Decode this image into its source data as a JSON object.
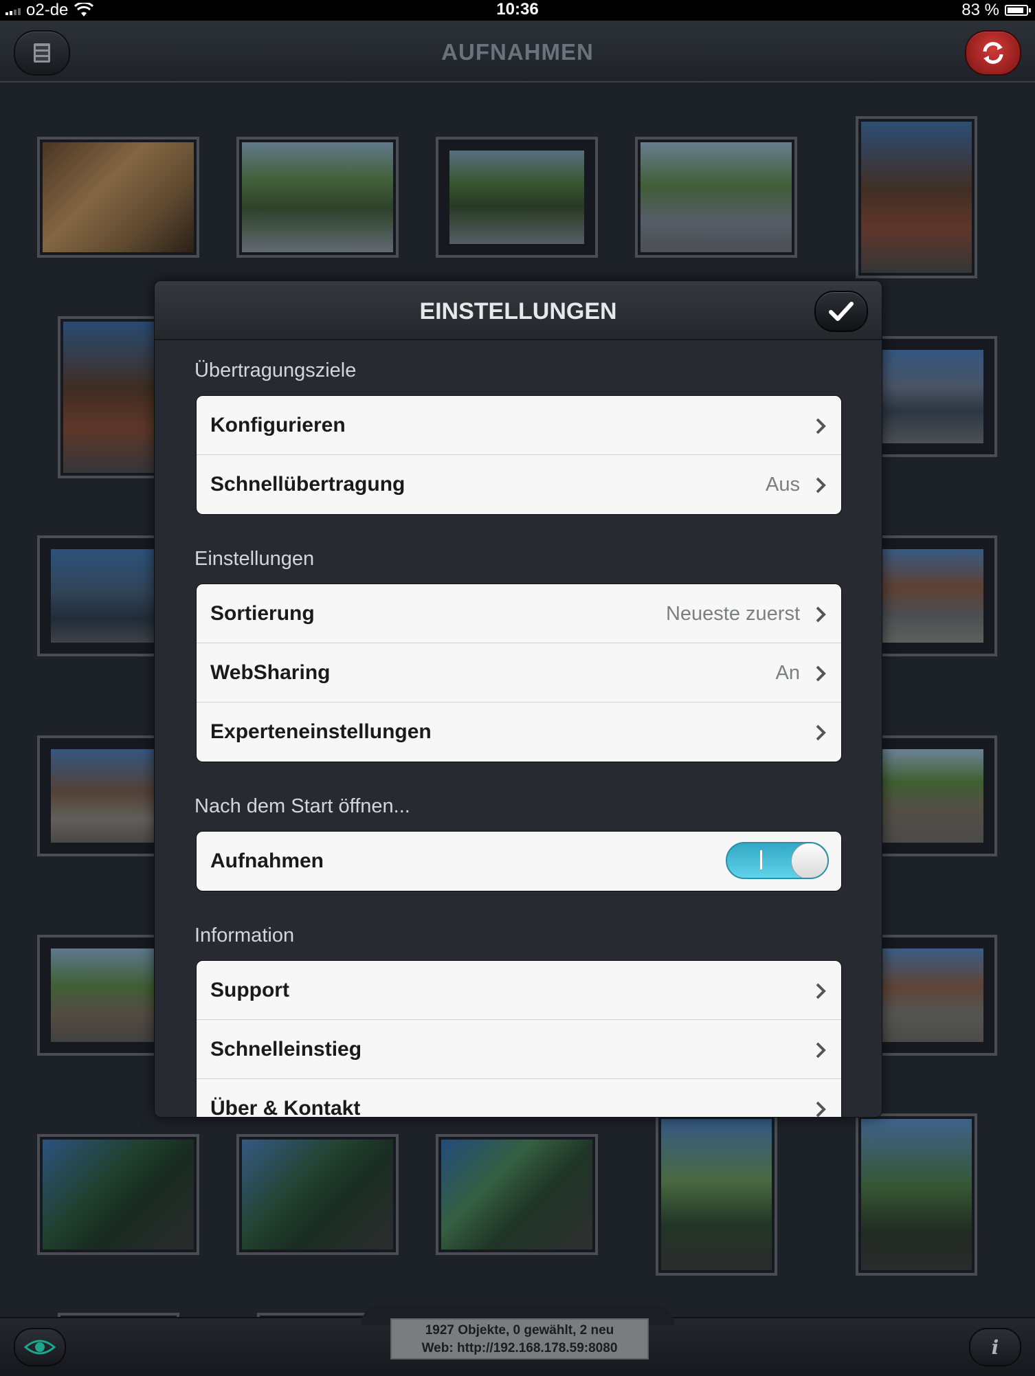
{
  "status_bar": {
    "carrier": "o2-de",
    "time": "10:36",
    "battery": "83 %"
  },
  "nav": {
    "title": "AUFNAHMEN",
    "left_icon": "cabinet-icon",
    "right_icon": "sync-icon"
  },
  "modal": {
    "title": "EINSTELLUNGEN",
    "done_icon": "checkmark-icon",
    "sections": [
      {
        "label": "Übertragungsziele",
        "rows": [
          {
            "label": "Konfigurieren",
            "value": ""
          },
          {
            "label": "Schnellübertragung",
            "value": "Aus"
          }
        ]
      },
      {
        "label": "Einstellungen",
        "rows": [
          {
            "label": "Sortierung",
            "value": "Neueste zuerst"
          },
          {
            "label": "WebSharing",
            "value": "An"
          },
          {
            "label": "Experteneinstellungen",
            "value": ""
          }
        ]
      },
      {
        "label": "Nach dem Start öffnen...",
        "rows": [
          {
            "label": "Aufnahmen",
            "toggle": true
          }
        ]
      },
      {
        "label": "Information",
        "rows": [
          {
            "label": "Support",
            "value": ""
          },
          {
            "label": "Schnelleinstieg",
            "value": ""
          },
          {
            "label": "Über & Kontakt",
            "value": ""
          }
        ]
      }
    ]
  },
  "footer": {
    "line1": "1927 Objekte, 0 gewählt, 2 neu",
    "line2": "Web: http://192.168.178.59:8080",
    "left_icon": "eye-icon",
    "right_icon": "info-icon",
    "info_glyph": "i"
  },
  "colors": {
    "background": "#262b32",
    "toggle_on": "#4ec3de",
    "sync_button": "#c0302e"
  }
}
